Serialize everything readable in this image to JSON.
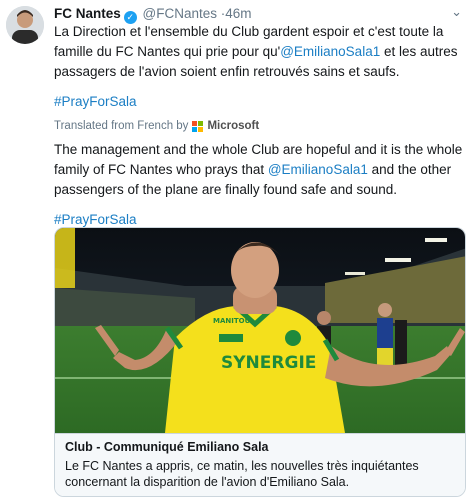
{
  "tweet": {
    "author_name": "FC Nantes",
    "handle": "@FCNantes",
    "time": "46m",
    "original_text_parts": [
      "La Direction et l'ensemble du Club gardent espoir et c'est toute la famille du FC Nantes qui prie pour qu'",
      "@EmilianoSala1",
      " et les autres passagers de l'avion soient enfin retrouvés sains et saufs."
    ],
    "hashtag": "#PrayForSala",
    "translated_from": "Translated from French by",
    "translator": "Microsoft",
    "translated_text_parts": [
      "The management and the whole Club are hopeful and it is the whole family of FC Nantes who prays that ",
      "@EmilianoSala1",
      " and the other passengers of the plane are finally found safe and sound."
    ],
    "translated_hashtag": "#PrayForSala"
  },
  "card": {
    "title": "Club - Communiqué Emiliano Sala",
    "description": "Le FC Nantes a appris, ce matin, les nouvelles très inquiétantes concernant la disparition de l'avion d'Emiliano Sala.",
    "shirt_sponsor": "SYNERGIE",
    "shirt_brand": "MANITOU"
  },
  "icons": {
    "verified": "verified-badge-icon",
    "chevron": "chevron-down-icon",
    "microsoft": "microsoft-logo-icon"
  },
  "colors": {
    "link": "#1b7ec4",
    "verified": "#1da1f2",
    "jersey_yellow": "#f4e01c",
    "jersey_green": "#1f8a3c"
  }
}
